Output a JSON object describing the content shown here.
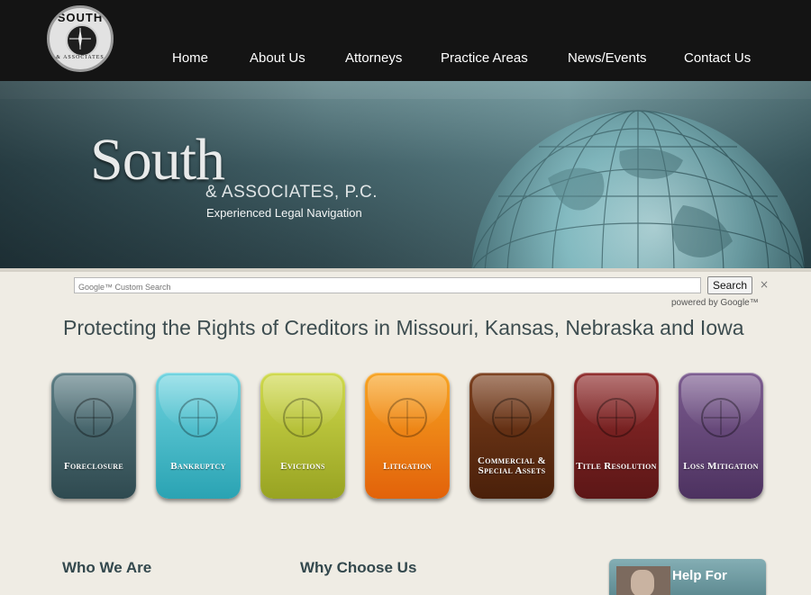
{
  "logo": {
    "text_top": "SOUTH",
    "text_bottom": "& ASSOCIATES"
  },
  "nav": {
    "items": [
      {
        "label": "Home"
      },
      {
        "label": "About Us"
      },
      {
        "label": "Attorneys"
      },
      {
        "label": "Practice Areas"
      },
      {
        "label": "News/Events"
      },
      {
        "label": "Contact Us"
      }
    ]
  },
  "banner": {
    "brand": "South",
    "subtitle": "& ASSOCIATES, P.C.",
    "tagline": "Experienced Legal Navigation"
  },
  "search": {
    "placeholder": "Google™ Custom Search",
    "button_label": "Search",
    "clear_symbol": "×",
    "powered_by": "powered by Google™"
  },
  "headline": "Protecting the Rights of Creditors in Missouri, Kansas, Nebraska and Iowa",
  "practice_tiles": [
    {
      "label": "Foreclosure",
      "color": "#3f5f66"
    },
    {
      "label": "Bankruptcy",
      "color": "#3fb6c5"
    },
    {
      "label": "Evictions",
      "color": "#a9b52b"
    },
    {
      "label": "Litigation",
      "color": "#e8780c"
    },
    {
      "label": "Commercial & Special Assets",
      "color": "#5a2a10"
    },
    {
      "label": "Title Resolution",
      "color": "#6e1c1c"
    },
    {
      "label": "Loss Mitigation",
      "color": "#5e3f72"
    }
  ],
  "sections": {
    "who_we_are": "Who We Are",
    "why_choose_us": "Why Choose Us",
    "help_for": "Help For"
  },
  "icons": {
    "logo": "compass-emblem-icon",
    "tile": "compass-emblem-icon",
    "clear": "close-icon"
  }
}
